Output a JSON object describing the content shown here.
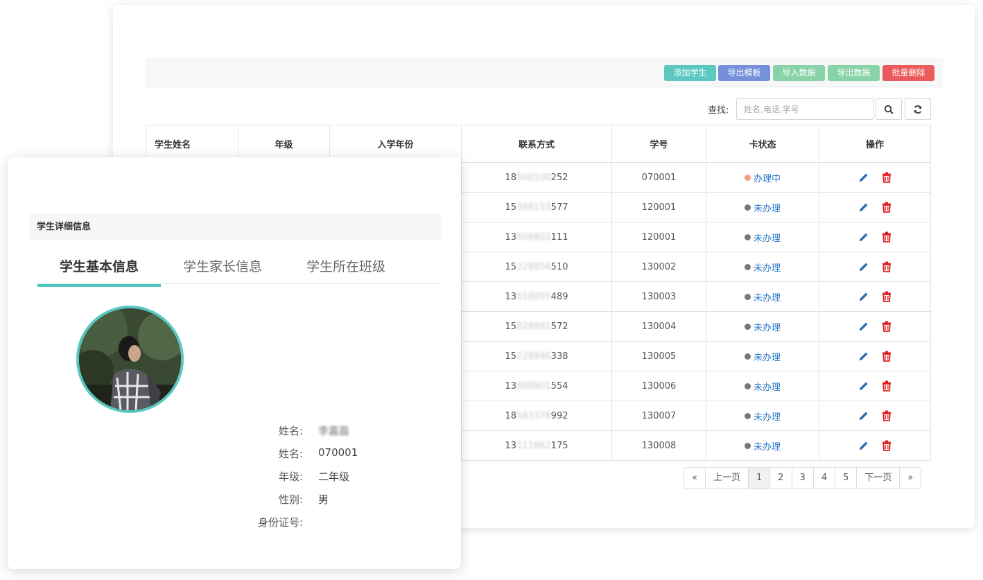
{
  "toolbar": {
    "buttons": [
      {
        "label": "添加学生",
        "color": "#5cc9c1"
      },
      {
        "label": "导出模板",
        "color": "#7590db"
      },
      {
        "label": "导入数据",
        "color": "#88d3a8"
      },
      {
        "label": "导出数据",
        "color": "#88d3a8"
      },
      {
        "label": "批量删除",
        "color": "#ec5b5b"
      }
    ]
  },
  "search": {
    "label": "查找:",
    "placeholder": "姓名,电话,学号",
    "search_icon": "search-icon",
    "refresh_icon": "refresh-icon"
  },
  "table": {
    "headers": [
      "学生姓名",
      "年级",
      "入学年份",
      "联系方式",
      "学号",
      "卡状态",
      "操作"
    ],
    "rows": [
      {
        "phone_a": "18",
        "phone_b": "500100",
        "phone_c": "252",
        "id": "070001",
        "status": "办理中",
        "status_color": "#f4a07a"
      },
      {
        "phone_a": "15",
        "phone_b": "388153",
        "phone_c": "577",
        "id": "120001",
        "status": "未办理",
        "status_color": "#777777"
      },
      {
        "phone_a": "13",
        "phone_b": "808802",
        "phone_c": "111",
        "id": "120001",
        "status": "未办理",
        "status_color": "#777777"
      },
      {
        "phone_a": "15",
        "phone_b": "228856",
        "phone_c": "510",
        "id": "130002",
        "status": "未办理",
        "status_color": "#777777"
      },
      {
        "phone_a": "13",
        "phone_b": "618095",
        "phone_c": "489",
        "id": "130003",
        "status": "未办理",
        "status_color": "#777777"
      },
      {
        "phone_a": "15",
        "phone_b": "828881",
        "phone_c": "572",
        "id": "130004",
        "status": "未办理",
        "status_color": "#777777"
      },
      {
        "phone_a": "15",
        "phone_b": "228846",
        "phone_c": "338",
        "id": "130005",
        "status": "未办理",
        "status_color": "#777777"
      },
      {
        "phone_a": "13",
        "phone_b": "888801",
        "phone_c": "554",
        "id": "130006",
        "status": "未办理",
        "status_color": "#777777"
      },
      {
        "phone_a": "18",
        "phone_b": "583378",
        "phone_c": "992",
        "id": "130007",
        "status": "未办理",
        "status_color": "#777777"
      },
      {
        "phone_a": "13",
        "phone_b": "111862",
        "phone_c": "175",
        "id": "130008",
        "status": "未办理",
        "status_color": "#777777"
      }
    ],
    "edit_icon": "pencil-icon",
    "delete_icon": "trash-icon"
  },
  "pager": {
    "first": "«",
    "prev": "上一页",
    "pages": [
      "1",
      "2",
      "3",
      "4",
      "5"
    ],
    "next": "下一页",
    "last": "»",
    "current": "1"
  },
  "detail": {
    "title": "学生详细信息",
    "tabs": [
      "学生基本信息",
      "学生家长信息",
      "学生所在班级"
    ],
    "fields": [
      {
        "label": "姓名:",
        "value": "李嘉磊"
      },
      {
        "label": "姓名:",
        "value": "070001"
      },
      {
        "label": "年级:",
        "value": "二年级"
      },
      {
        "label": "性别:",
        "value": "男"
      },
      {
        "label": "身份证号:",
        "value": ""
      }
    ],
    "accent": "#4fc4bd"
  }
}
